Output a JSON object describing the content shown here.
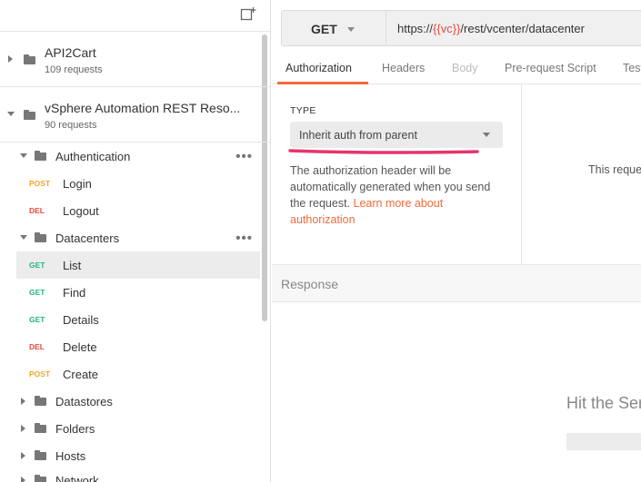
{
  "sidebar": {
    "collections": [
      {
        "name": "API2Cart",
        "count": "109 requests",
        "expanded": false
      },
      {
        "name": "vSphere Automation REST Reso...",
        "count": "90 requests",
        "expanded": true
      }
    ],
    "authentication": {
      "label": "Authentication",
      "more": "•••"
    },
    "login": {
      "method": "POST",
      "label": "Login"
    },
    "logout": {
      "method": "DEL",
      "label": "Logout"
    },
    "datacenters": {
      "label": "Datacenters",
      "more": "•••"
    },
    "list": {
      "method": "GET",
      "label": "List"
    },
    "find": {
      "method": "GET",
      "label": "Find"
    },
    "details": {
      "method": "GET",
      "label": "Details"
    },
    "delete": {
      "method": "DEL",
      "label": "Delete"
    },
    "create": {
      "method": "POST",
      "label": "Create"
    },
    "datastores": {
      "label": "Datastores"
    },
    "folders": {
      "label": "Folders"
    },
    "hosts": {
      "label": "Hosts"
    },
    "network": {
      "label": "Network"
    }
  },
  "request": {
    "method": "GET",
    "url_prefix": "https://",
    "url_var": "{{vc}}",
    "url_suffix": "/rest/vcenter/datacenter"
  },
  "tabs": {
    "authorization": "Authorization",
    "headers": "Headers",
    "body": "Body",
    "prerequest": "Pre-request Script",
    "tests": "Tests"
  },
  "auth": {
    "type_label": "TYPE",
    "type_value": "Inherit auth from parent",
    "description": "The authorization header will be automatically generated when you send the request. ",
    "link": "Learn more about authorization"
  },
  "right_panel": {
    "message": "This request"
  },
  "response": {
    "title": "Response",
    "hint": "Hit the Send"
  },
  "colors": {
    "accent": "#f26b3a",
    "annotation": "#e8336b",
    "post": "#f5a623",
    "delete": "#e64a3b",
    "get": "#26b47f"
  }
}
